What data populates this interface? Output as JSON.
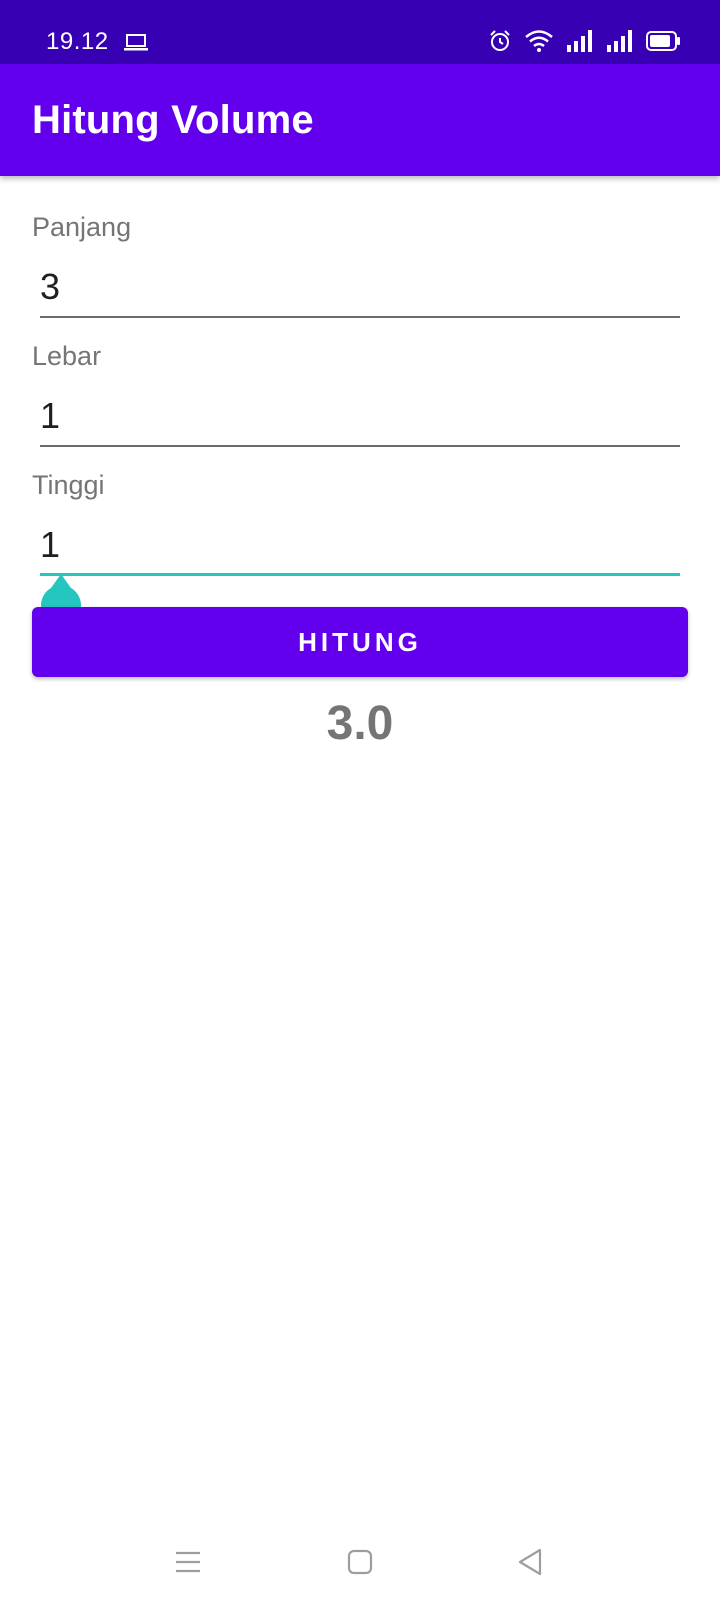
{
  "status_bar": {
    "time": "19.12",
    "icons": [
      "laptop-icon",
      "alarm-icon",
      "wifi-icon",
      "signal-icon",
      "signal-icon",
      "battery-icon"
    ]
  },
  "app_bar": {
    "title": "Hitung Volume",
    "color": "#6200ee"
  },
  "form": {
    "panjang": {
      "label": "Panjang",
      "value": "3"
    },
    "lebar": {
      "label": "Lebar",
      "value": "1"
    },
    "tinggi": {
      "label": "Tinggi",
      "value": "1"
    }
  },
  "button": {
    "label": "HITUNG"
  },
  "result": {
    "value": "3.0"
  },
  "nav_bar": {
    "icons": [
      "menu-icon",
      "home-icon",
      "back-icon"
    ]
  },
  "colors": {
    "primary": "#6200ee",
    "primary_dark": "#3700b3",
    "accent": "#26c6c0"
  }
}
